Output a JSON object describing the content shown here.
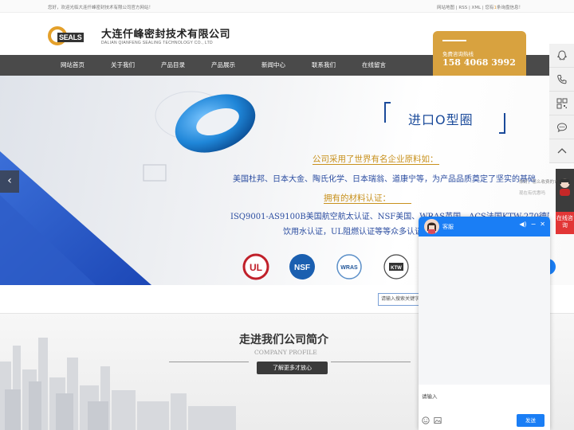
{
  "topbar": {
    "welcome": "您好，欢迎光临大连仟峰密封技术有限公司官方网站！",
    "links": "网站地图 | RSS | XML | 您有",
    "highlight": "1",
    "links_tail": "条询盘信息！"
  },
  "header": {
    "logo_mark": "SEALS",
    "company_cn": "大连仟峰密封技术有限公司",
    "company_en": "DALIAN QIANFENG SEALING TECHNOLOGY CO., LTD",
    "hotline_label": "免费咨询热线",
    "hotline_number": "158 4068 3992",
    "accent_color": "#d8a23f"
  },
  "nav": {
    "items": [
      "网站首页",
      "关于我们",
      "产品目录",
      "产品展示",
      "新闻中心",
      "联系我们",
      "在线留言"
    ]
  },
  "banner": {
    "title": "进口O型圈",
    "line1": "公司采用了世界有名企业原料如：",
    "line2": "美国杜邦、日本大金、陶氏化学、日本瑞翁、道康宁等，为产品品质奠定了坚实的基础",
    "line3": "拥有的材料认证：",
    "line4": "ISQ9001-AS9100B美国航空航太认证、NSF美国、WRAS英国、ACS法国KTW-270德国",
    "line5": "饮用水认证，UL阻燃认证等等众多认证",
    "certs": [
      "UL",
      "NSF",
      "WRAS",
      "KTW"
    ],
    "prev_icon": "chevron-left-icon"
  },
  "search": {
    "placeholder": "请输入搜索关键字"
  },
  "profile": {
    "title": "走进我们公司简介",
    "subtitle": "COMPANY PROFILE",
    "more_label": "了解更多才放心"
  },
  "float_tools": {
    "icons": [
      "qq-icon",
      "phone-icon",
      "qrcode-icon",
      "chat-icon",
      "back-to-top-icon"
    ],
    "online_label": "在线咨询",
    "hint1": "你好，怎么收费的?",
    "hint2": "现在有优惠吗"
  },
  "chat": {
    "agent_name": "客服",
    "input_placeholder": "请输入",
    "send_label": "发送",
    "header_color": "#1a7ef5"
  }
}
